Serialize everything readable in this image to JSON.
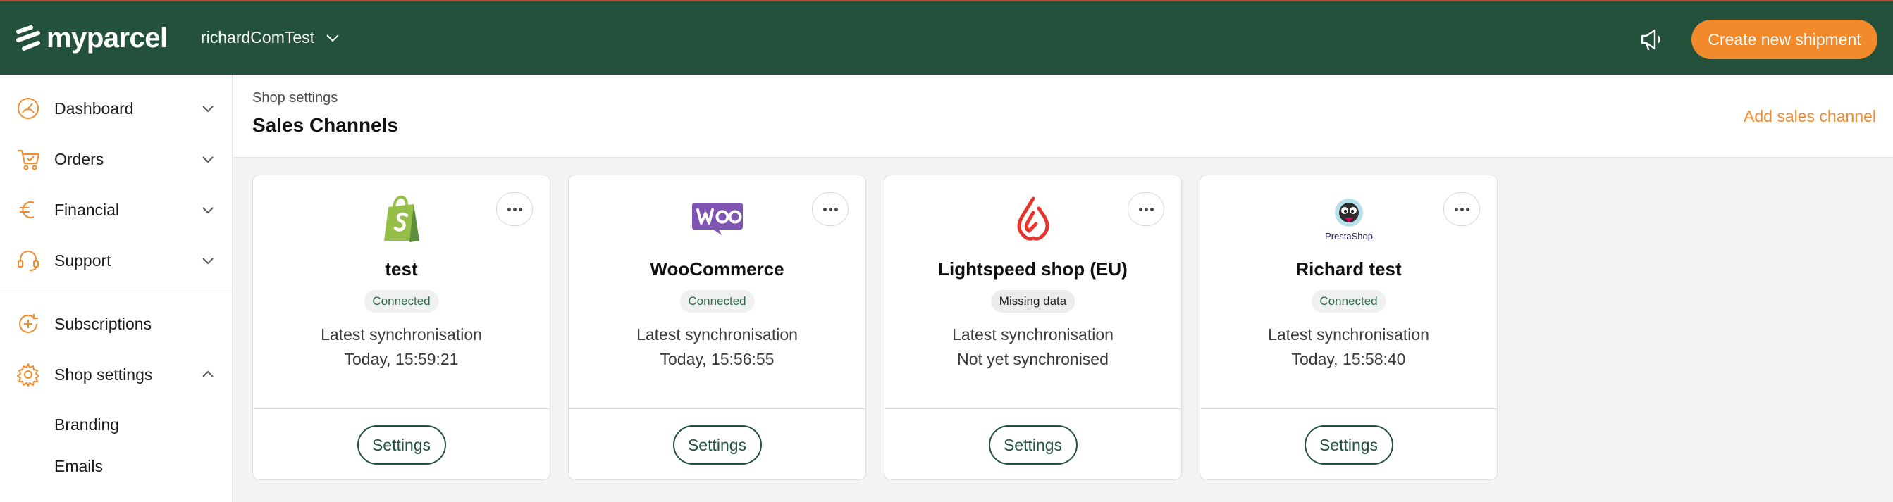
{
  "header": {
    "brand": "myparcel",
    "account_name": "richardComTest",
    "create_button": "Create new shipment",
    "colors": {
      "background": "#23513c",
      "accent": "#f28a2b"
    }
  },
  "sidebar": {
    "items": [
      {
        "label": "Dashboard",
        "icon": "dashboard-icon"
      },
      {
        "label": "Orders",
        "icon": "cart-icon"
      },
      {
        "label": "Financial",
        "icon": "euro-icon"
      },
      {
        "label": "Support",
        "icon": "headset-icon"
      },
      {
        "label": "Subscriptions",
        "icon": "subscriptions-icon"
      },
      {
        "label": "Shop settings",
        "icon": "gear-icon"
      }
    ],
    "sub_items": [
      "Branding",
      "Emails"
    ]
  },
  "page": {
    "breadcrumb": "Shop settings",
    "title": "Sales Channels",
    "add_link": "Add sales channel"
  },
  "channels": [
    {
      "name": "test",
      "platform": "shopify-logo",
      "status": "Connected",
      "sync_label": "Latest synchronisation",
      "sync_time": "Today, 15:59:21",
      "button": "Settings"
    },
    {
      "name": "WooCommerce",
      "platform": "woocommerce-logo",
      "status": "Connected",
      "sync_label": "Latest synchronisation",
      "sync_time": "Today, 15:56:55",
      "button": "Settings"
    },
    {
      "name": "Lightspeed shop (EU)",
      "platform": "lightspeed-logo",
      "status": "Missing data",
      "sync_label": "Latest synchronisation",
      "sync_time": "Not yet synchronised",
      "button": "Settings"
    },
    {
      "name": "Richard test",
      "platform": "prestashop-logo",
      "logo_text": "PrestaShop",
      "status": "Connected",
      "sync_label": "Latest synchronisation",
      "sync_time": "Today, 15:58:40",
      "button": "Settings"
    }
  ]
}
